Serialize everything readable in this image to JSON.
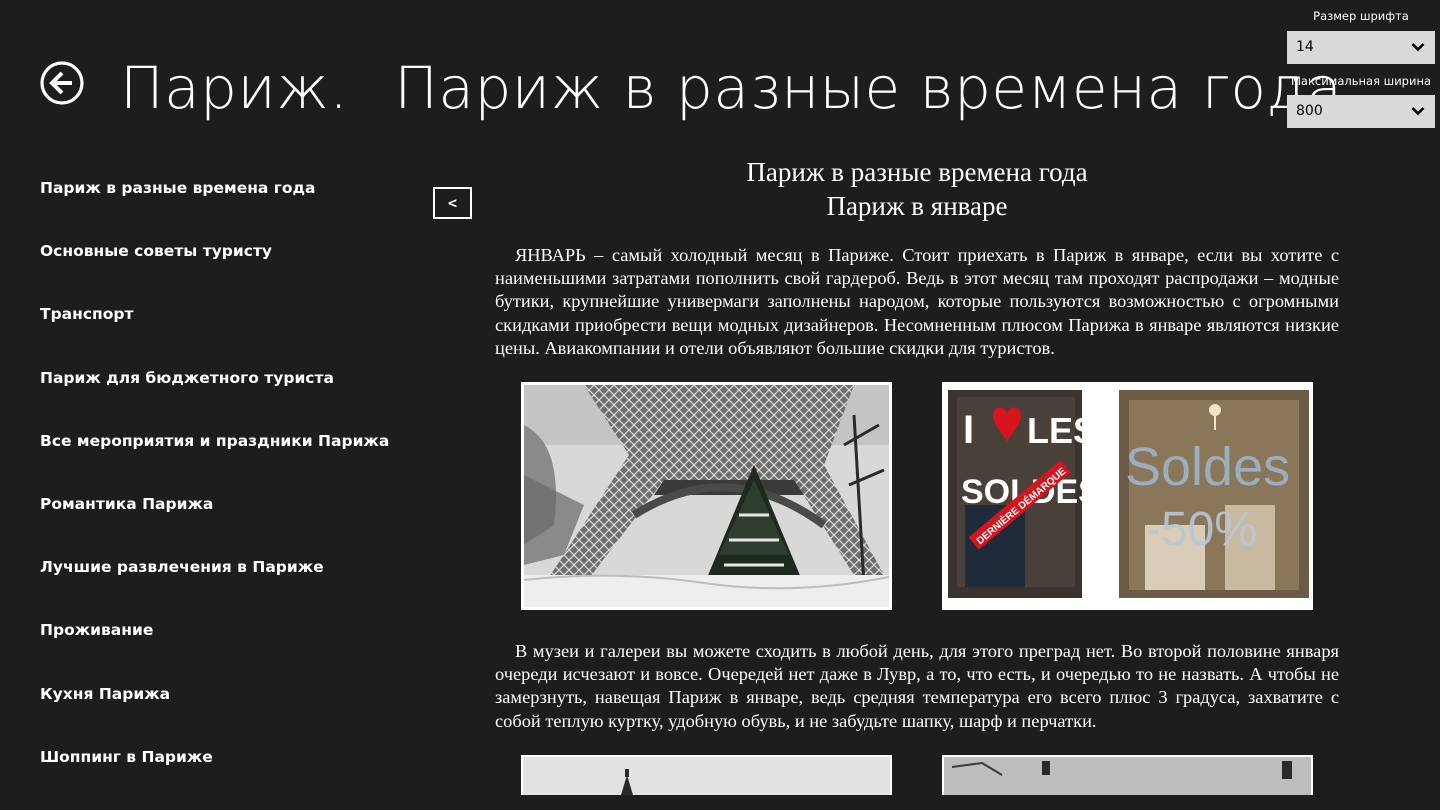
{
  "header": {
    "title_part1": "Париж.",
    "title_part2": "Париж в разные времена года"
  },
  "settings": {
    "font_size_label": "Размер шрифта",
    "font_size_value": "14",
    "max_width_label": "Максимальная ширина",
    "max_width_value": "800"
  },
  "sidebar": {
    "items": [
      {
        "label": "Париж в разные времена года"
      },
      {
        "label": "Основные советы туристу"
      },
      {
        "label": "Транспорт"
      },
      {
        "label": "Париж для бюджетного туриста"
      },
      {
        "label": "Все мероприятия и праздники Парижа"
      },
      {
        "label": "Романтика Парижа"
      },
      {
        "label": "Лучшие развлечения в Париже"
      },
      {
        "label": "Проживание"
      },
      {
        "label": "Кухня Парижа"
      },
      {
        "label": "Шоппинг в Париже"
      }
    ]
  },
  "collapse_button_label": "<",
  "article": {
    "title_line1": "Париж в разные времена года",
    "title_line2": "Париж в январе",
    "paragraph1": "ЯНВАРЬ – самый холодный месяц в Париже. Стоит приехать в Париж в январе, если вы хотите с наименьшими затратами пополнить свой гардероб. Ведь в этот месяц там проходят распродажи – модные бутики, крупнейшие универмаги заполнены народом, которые пользуются возможностью с огромными скидками приобрести вещи модных дизайнеров. Несомненным плюсом Парижа в январе являются низкие цены. Авиакомпании и отели объявляют большие скидки для туристов.",
    "paragraph2": "В музеи и галереи вы можете сходить в любой день, для этого преград нет. Во второй половине января очереди исчезают и вовсе. Очередей нет даже в Лувр, а то, что есть, и очередью то не назвать. А чтобы не замерзнуть, навещая Париж в январе, ведь средняя температура его всего плюс 3 градуса, захватите с собой теплую куртку, удобную обувь, и не забудьте шапку, шарф и перчатки.",
    "sale_sign": {
      "line1": "I",
      "line1b": "LES",
      "line2": "SOLDES",
      "banner": "DERNIÈRE DÉMARQUE",
      "right_word": "Soldes",
      "right_discount": "-50%"
    }
  },
  "colors": {
    "background": "#1d1d1d",
    "select_background": "#d9d9d9",
    "heart": "#d7141d"
  },
  "icons": {
    "back": "back-arrow-circle-icon",
    "chevron": "chevron-down-icon"
  }
}
